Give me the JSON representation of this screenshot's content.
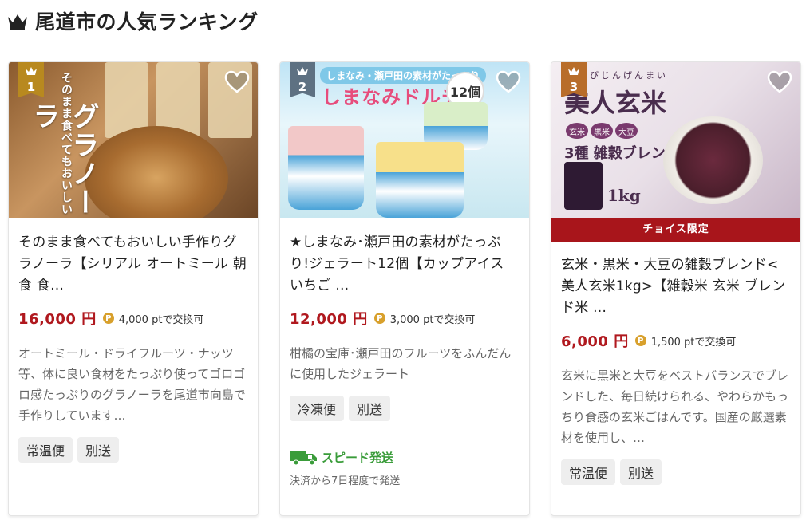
{
  "header": {
    "title": "尾道市の人気ランキング"
  },
  "cards": [
    {
      "rank": "1",
      "image": {
        "vertical_small": "そのまま食べてもおいしい",
        "vertical_big": "グラノーラ"
      },
      "title": "そのまま食べてもおいしい手作りグラノーラ【シリアル オートミール 朝食 食…",
      "price": "16,000 円",
      "points": "4,000 ptで交換可",
      "description": "オートミール・ドライフルーツ・ナッツ等、体に良い食材をたっぷり使ってゴロゴロ感たっぷりのグラノーラを尾道市向島で手作りしています…",
      "tags": [
        "常温便",
        "別送"
      ]
    },
    {
      "rank": "2",
      "image": {
        "banner": "しまなみ・瀬戸田の素材がたっぷり",
        "title": "しまなみドルチェ",
        "count": "12個"
      },
      "title": "★しまなみ･瀬戸田の素材がたっぷり!ジェラート12個【カップアイス いちご …",
      "price": "12,000 円",
      "points": "3,000 ptで交換可",
      "description": "柑橘の宝庫･瀬戸田のフルーツをふんだんに使用したジェラート",
      "tags": [
        "冷凍便",
        "別送"
      ],
      "speed_label": "スピード発送",
      "speed_note": "決済から7日程度で発送"
    },
    {
      "rank": "3",
      "image": {
        "subtitle": "びじんげんまい",
        "title": "美人玄米",
        "tags": [
          "玄米",
          "黒米",
          "大豆"
        ],
        "blend": "3種 雑穀ブレンド",
        "weight": "1kg"
      },
      "choice_label": "チョイス限定",
      "title": "玄米・黒米・大豆の雑穀ブレンド<美人玄米1kg>【雑穀米 玄米 ブレンド米 …",
      "price": "6,000 円",
      "points": "1,500 ptで交換可",
      "description": "玄米に黒米と大豆をベストバランスでブレンドした、毎日続けられる、やわらかもっちり食感の玄米ごはんです。国産の厳選素材を使用し、…",
      "tags": [
        "常温便",
        "別送"
      ]
    }
  ],
  "icons": {
    "crown": "crown-icon",
    "favorite": "heart-icon",
    "point": "point-coin-icon",
    "truck": "truck-icon"
  },
  "colors": {
    "price": "#b0181e",
    "choice_bar": "#a8151b",
    "speed": "#3a9c3a",
    "rank1": "#b8891f",
    "rank2": "#5e7182",
    "rank3": "#b86d2a"
  }
}
